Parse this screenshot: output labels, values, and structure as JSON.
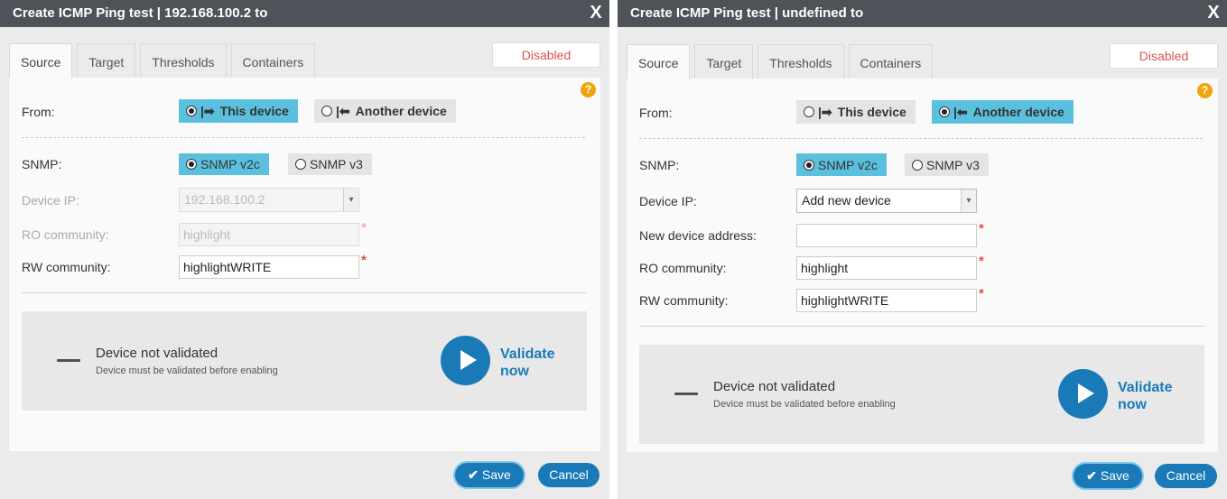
{
  "left": {
    "title": "Create ICMP Ping test | 192.168.100.2 to",
    "close_label": "X",
    "tabs": [
      "Source",
      "Target",
      "Thresholds",
      "Containers"
    ],
    "status": "Disabled",
    "help": "?",
    "from_label": "From:",
    "from_this": "This device",
    "from_another": "Another device",
    "snmp_label": "SNMP:",
    "snmp_v2c": "SNMP v2c",
    "snmp_v3": "SNMP v3",
    "device_ip_label": "Device IP:",
    "device_ip_value": "192.168.100.2",
    "ro_label": "RO community:",
    "ro_value": "highlight",
    "rw_label": "RW community:",
    "rw_value": "highlightWRITE",
    "req": "*",
    "validation_title": "Device not validated",
    "validation_sub": "Device must be validated before enabling",
    "validate_1": "Validate",
    "validate_2": "now",
    "save": "Save",
    "cancel": "Cancel"
  },
  "right": {
    "title": "Create ICMP Ping test | undefined to",
    "close_label": "X",
    "tabs": [
      "Source",
      "Target",
      "Thresholds",
      "Containers"
    ],
    "status": "Disabled",
    "help": "?",
    "from_label": "From:",
    "from_this": "This device",
    "from_another": "Another device",
    "snmp_label": "SNMP:",
    "snmp_v2c": "SNMP v2c",
    "snmp_v3": "SNMP v3",
    "device_ip_label": "Device IP:",
    "device_ip_value": "Add new device",
    "new_addr_label": "New device address:",
    "new_addr_value": "",
    "ro_label": "RO community:",
    "ro_value": "highlight",
    "rw_label": "RW community:",
    "rw_value": "highlightWRITE",
    "req": "*",
    "validation_title": "Device not validated",
    "validation_sub": "Device must be validated before enabling",
    "validate_1": "Validate",
    "validate_2": "now",
    "save": "Save",
    "cancel": "Cancel"
  },
  "icons": {
    "check": "✔",
    "caret": "▾",
    "arrow_out": "|➡",
    "arrow_in": "|⬅"
  }
}
